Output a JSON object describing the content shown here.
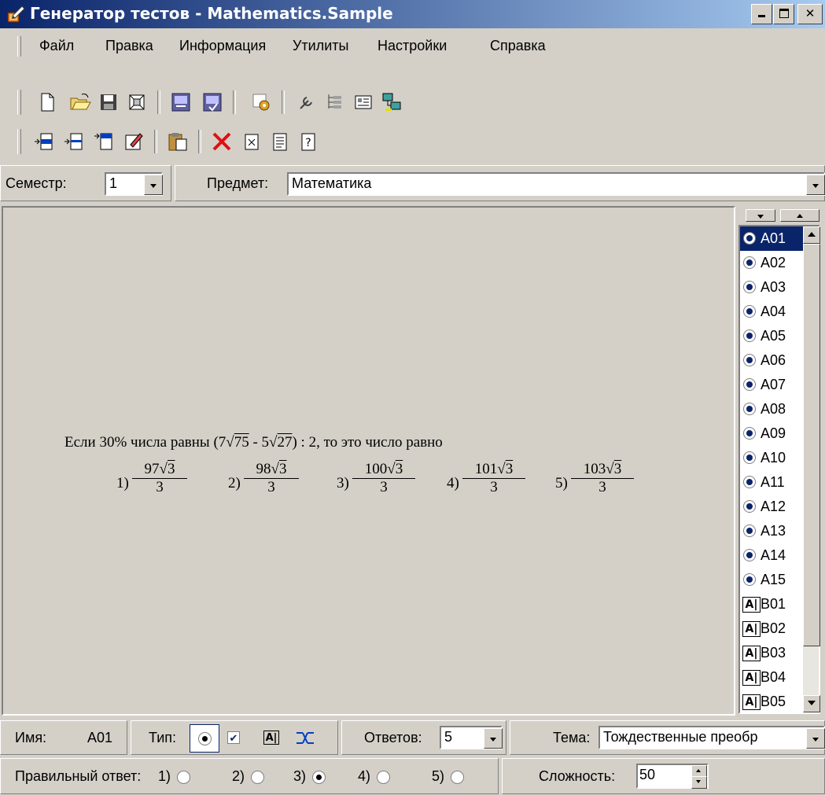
{
  "window": {
    "title": "Генератор тестов - Mathematics.Sample"
  },
  "menu": [
    "Файл",
    "Правка",
    "Информация",
    "Утилиты",
    "Настройки",
    "Справка"
  ],
  "semester": {
    "label": "Семестр:",
    "value": "1"
  },
  "subject": {
    "label": "Предмет:",
    "value": "Математика"
  },
  "question": {
    "text_prefix": "Если  30% числа равны  ",
    "expr_open": "(7",
    "rad1": "75",
    "expr_mid": " - 5",
    "rad2": "27",
    "expr_close": ") : 2, то это число равно",
    "options": [
      {
        "index": "1)",
        "num": "97",
        "rad": "3",
        "den": "3"
      },
      {
        "index": "2)",
        "num": "98",
        "rad": "3",
        "den": "3"
      },
      {
        "index": "3)",
        "num": "100",
        "rad": "3",
        "den": "3"
      },
      {
        "index": "4)",
        "num": "101",
        "rad": "3",
        "den": "3"
      },
      {
        "index": "5)",
        "num": "103",
        "rad": "3",
        "den": "3"
      }
    ]
  },
  "question_list": [
    "A01",
    "A02",
    "A03",
    "A04",
    "A05",
    "A06",
    "A07",
    "A08",
    "A09",
    "A10",
    "A11",
    "A12",
    "A13",
    "A14",
    "A15",
    "B01",
    "B02",
    "B03",
    "B04",
    "B05"
  ],
  "selected_question": "A01",
  "status": {
    "name_label": "Имя:",
    "name_value": "A01",
    "type_label": "Тип:",
    "answers_label": "Ответов:",
    "answers_value": "5",
    "topic_label": "Тема:",
    "topic_value": "Тождественные преобр",
    "correct_label": "Правильный ответ:",
    "answer_options": [
      "1)",
      "2)",
      "3)",
      "4)",
      "5)"
    ],
    "correct_answer": "3)",
    "difficulty_label": "Сложность:",
    "difficulty_value": "50"
  },
  "colors": {
    "titlebar": "#0a246a",
    "selection": "#0a246a",
    "face": "#d4d0c8"
  }
}
